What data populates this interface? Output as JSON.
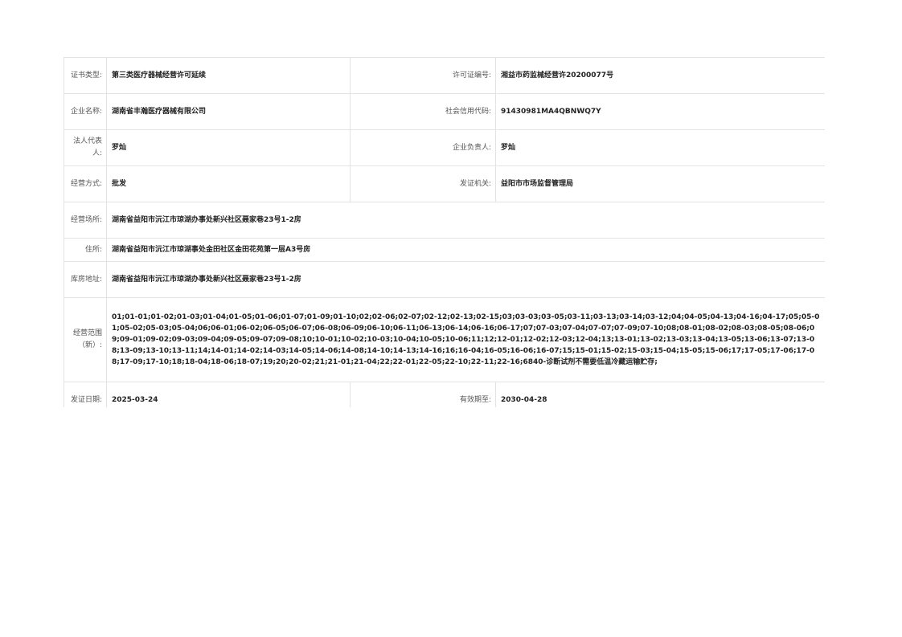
{
  "licence": {
    "cert_type_label": "证书类型:",
    "cert_type": "第三类医疗器械经营许可延续",
    "licence_no_label": "许可证编号:",
    "licence_no": "湘益市药监械经营许20200077号",
    "company_name_label": "企业名称:",
    "company_name": "湖南省丰瀚医疗器械有限公司",
    "credit_code_label": "社会信用代码:",
    "credit_code": "91430981MA4QBNWQ7Y",
    "legal_rep_label": "法人代表人:",
    "legal_rep": "罗灿",
    "manager_label": "企业负责人:",
    "manager": "罗灿",
    "biz_mode_label": "经营方式:",
    "biz_mode": "批发",
    "issuer_label": "发证机关:",
    "issuer": "益阳市市场监督管理局",
    "premises_label": "经营场所:",
    "premises": "湖南省益阳市沅江市琼湖办事处新兴社区聂家巷23号1-2房",
    "residence_label": "住所:",
    "residence": "湖南省益阳市沅江市琼湖事处金田社区金田花苑第一层A3号房",
    "warehouse_label": "库房地址:",
    "warehouse": "湖南省益阳市沅江市琼湖办事处新兴社区聂家巷23号1-2房",
    "scope_label": "经营范围（新）:",
    "scope": "01;01-01;01-02;01-03;01-04;01-05;01-06;01-07;01-09;01-10;02;02-06;02-07;02-12;02-13;02-15;03;03-03;03-05;03-11;03-13;03-14;03-12;04;04-05;04-13;04-16;04-17;05;05-01;05-02;05-03;05-04;06;06-01;06-02;06-05;06-07;06-08;06-09;06-10;06-11;06-13;06-14;06-16;06-17;07;07-03;07-04;07-07;07-09;07-10;08;08-01;08-02;08-03;08-05;08-06;09;09-01;09-02;09-03;09-04;09-05;09-07;09-08;10;10-01;10-02;10-03;10-04;10-05;10-06;11;12;12-01;12-02;12-03;12-04;13;13-01;13-02;13-03;13-04;13-05;13-06;13-07;13-08;13-09;13-10;13-11;14;14-01;14-02;14-03;14-05;14-06;14-08;14-10;14-13;14-16;16;16-04;16-05;16-06;16-07;15;15-01;15-02;15-03;15-04;15-05;15-06;17;17-05;17-06;17-08;17-09;17-10;18;18-04;18-06;18-07;19;20;20-02;21;21-01;21-04;22;22-01;22-05;22-10;22-11;22-16;6840-诊断试剂不需要低温冷藏运输贮存;",
    "issue_date_label": "发证日期:",
    "issue_date": "2025-03-24",
    "valid_until_label": "有效期至:",
    "valid_until": "2030-04-28"
  }
}
